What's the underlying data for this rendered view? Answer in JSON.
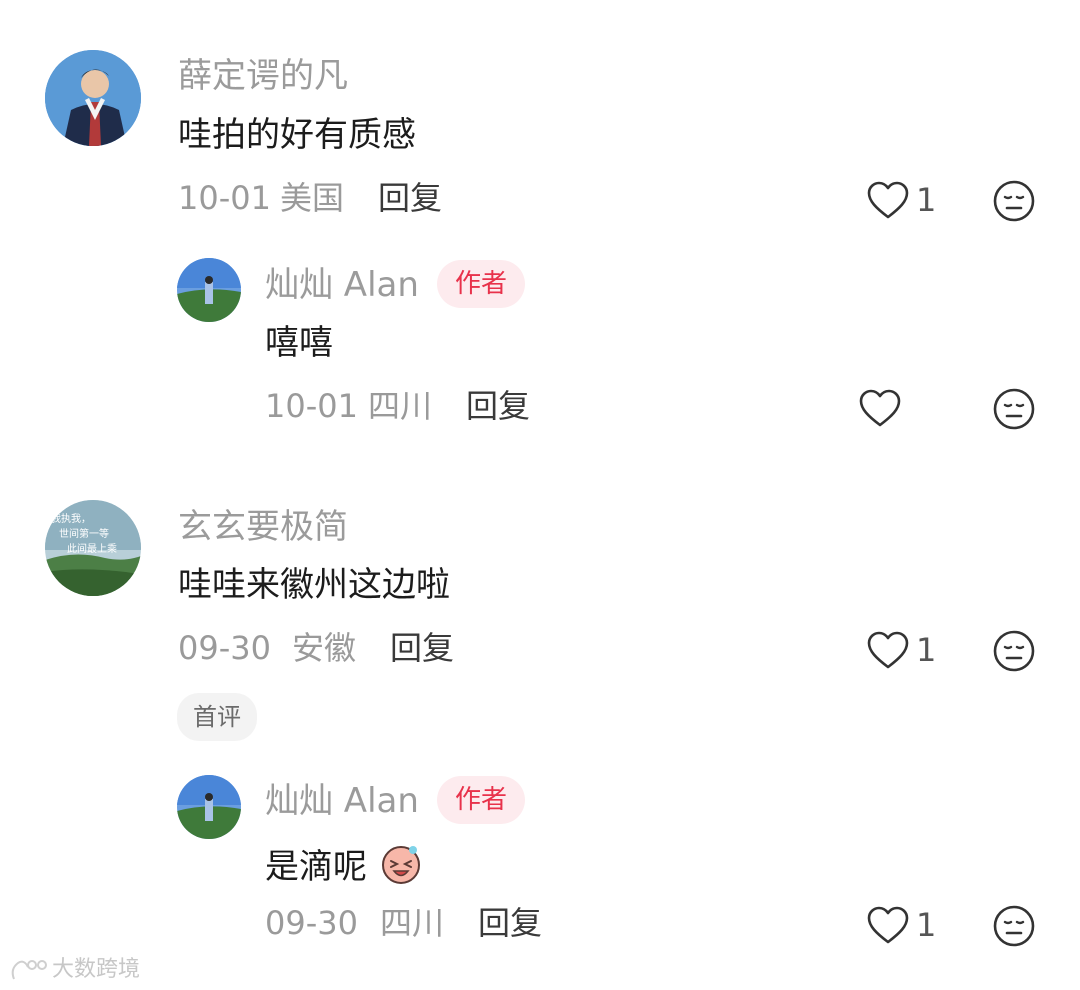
{
  "comments": [
    {
      "username": "薛定谔的凡",
      "text": "哇拍的好有质感",
      "date": "10-01",
      "location": "美国",
      "reply_label": "回复",
      "likes": "1",
      "replies": [
        {
          "username": "灿灿 Alan",
          "author_tag": "作者",
          "text": "嘻嘻",
          "date": "10-01",
          "location": "四川",
          "reply_label": "回复",
          "likes": ""
        }
      ]
    },
    {
      "username": "玄玄要极简",
      "text": "哇哇来徽州这边啦",
      "date": "09-30",
      "location": "安徽",
      "reply_label": "回复",
      "likes": "1",
      "first_tag": "首评",
      "replies": [
        {
          "username": "灿灿 Alan",
          "author_tag": "作者",
          "text": "是滴呢",
          "date": "09-30",
          "location": "四川",
          "reply_label": "回复",
          "likes": "1"
        }
      ]
    }
  ],
  "watermark": "大数跨境",
  "avatar_text_lines": [
    "我执我，",
    "世间第一等",
    "此间最上乘"
  ],
  "colors": {
    "author_tag_bg": "#fdebee",
    "author_tag_text": "#e8324b"
  }
}
